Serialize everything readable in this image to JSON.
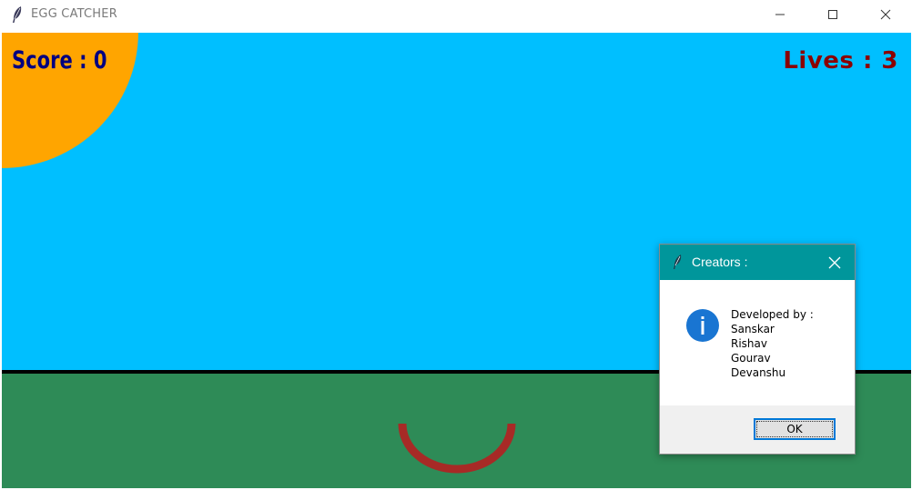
{
  "window": {
    "title": "EGG CATCHER",
    "icon": "feather-icon"
  },
  "game": {
    "score_text": "Score : 0",
    "lives_text": "Lives : 3",
    "colors": {
      "sky": "#00bfff",
      "sun": "#ffa500",
      "ground": "#2e8b57",
      "score": "#000080",
      "lives": "#8b0000",
      "catcher": "#b22222"
    }
  },
  "dialog": {
    "title": "Creators :",
    "icon": "info-icon",
    "lines": [
      "Developed by :",
      "Sanskar",
      "Rishav",
      "Gourav",
      "Devanshu"
    ],
    "ok_label": "OK",
    "title_color": "#00969b"
  }
}
